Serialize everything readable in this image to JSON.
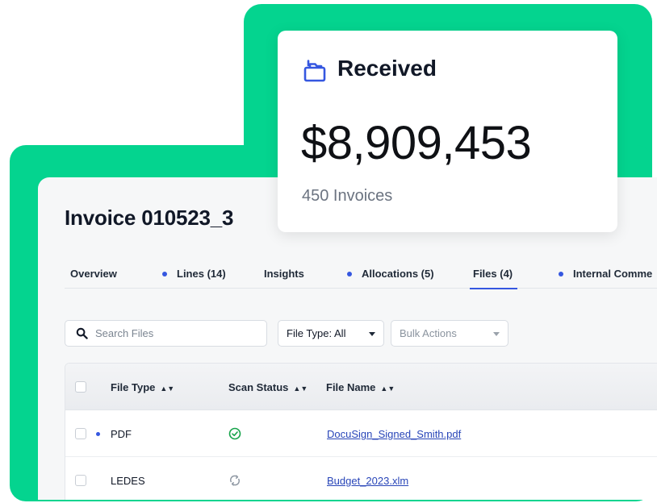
{
  "received_card": {
    "icon": "folder-stack-icon",
    "label": "Received",
    "amount": "$8,909,453",
    "invoice_count": "450 Invoices"
  },
  "invoice": {
    "title": "Invoice 010523_3"
  },
  "tabs": [
    {
      "label": "Overview",
      "dot": false,
      "active": false
    },
    {
      "label": "Lines (14)",
      "dot": true,
      "active": false
    },
    {
      "label": "Insights",
      "dot": false,
      "active": false
    },
    {
      "label": "Allocations (5)",
      "dot": true,
      "active": false
    },
    {
      "label": "Files (4)",
      "dot": false,
      "active": true
    },
    {
      "label": "Internal Comme",
      "dot": true,
      "active": false
    }
  ],
  "toolbar": {
    "search_placeholder": "Search Files",
    "file_type_select": "File Type: All",
    "bulk_actions_select": "Bulk Actions"
  },
  "table": {
    "columns": [
      "File Type",
      "Scan Status",
      "File Name"
    ],
    "rows": [
      {
        "file_type": "PDF",
        "scan_status": "check-circle-icon",
        "file_name": "DocuSign_Signed_Smith.pdf",
        "dot": true
      },
      {
        "file_type": "LEDES",
        "scan_status": "sync-icon",
        "file_name": "Budget_2023.xlm",
        "dot": false
      }
    ]
  },
  "colors": {
    "brand_green": "#04d48f",
    "accent_blue": "#3557e0",
    "link_blue": "#2845b8"
  }
}
